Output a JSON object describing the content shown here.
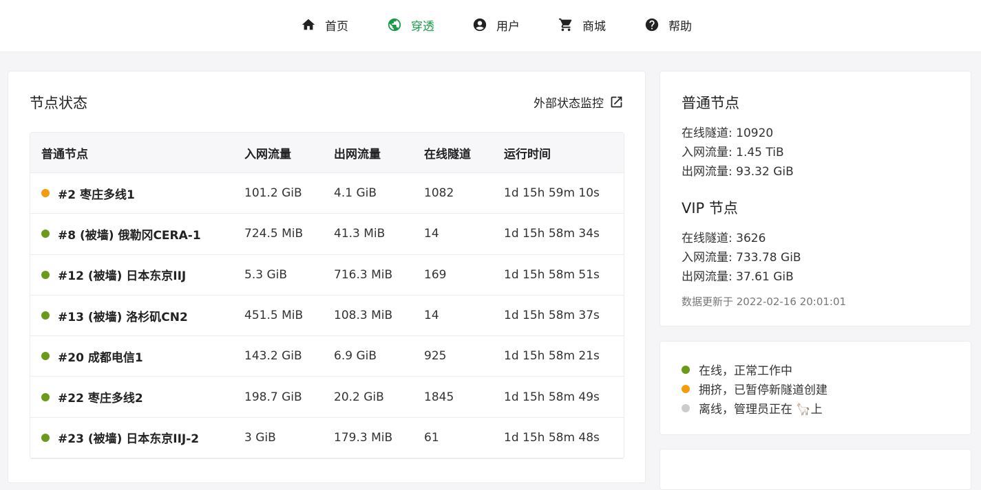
{
  "nav": {
    "items": [
      {
        "label": "首页",
        "icon": "home-icon"
      },
      {
        "label": "穿透",
        "icon": "globe-icon",
        "active": true
      },
      {
        "label": "用户",
        "icon": "account-circle-icon"
      },
      {
        "label": "商城",
        "icon": "shopping-cart-icon"
      },
      {
        "label": "帮助",
        "icon": "help-circle-icon"
      }
    ],
    "active_color": "#1a9a4a"
  },
  "node_status": {
    "title": "节点状态",
    "external_link": "外部状态监控",
    "columns": [
      "普通节点",
      "入网流量",
      "出网流量",
      "在线隧道",
      "运行时间"
    ],
    "rows": [
      {
        "status": "busy",
        "name": "#2 枣庄多线1",
        "in": "101.2 GiB",
        "out": "4.1 GiB",
        "tunnels": "1082",
        "uptime": "1d 15h 59m 10s"
      },
      {
        "status": "online",
        "name": "#8 (被墙) 俄勒冈CERA-1",
        "in": "724.5 MiB",
        "out": "41.3 MiB",
        "tunnels": "14",
        "uptime": "1d 15h 58m 34s"
      },
      {
        "status": "online",
        "name": "#12 (被墙) 日本东京IIJ",
        "in": "5.3 GiB",
        "out": "716.3 MiB",
        "tunnels": "169",
        "uptime": "1d 15h 58m 51s"
      },
      {
        "status": "online",
        "name": "#13 (被墙) 洛杉矶CN2",
        "in": "451.5 MiB",
        "out": "108.3 MiB",
        "tunnels": "14",
        "uptime": "1d 15h 58m 37s"
      },
      {
        "status": "online",
        "name": "#20 成都电信1",
        "in": "143.2 GiB",
        "out": "6.9 GiB",
        "tunnels": "925",
        "uptime": "1d 15h 58m 21s"
      },
      {
        "status": "online",
        "name": "#22 枣庄多线2",
        "in": "198.7 GiB",
        "out": "20.2 GiB",
        "tunnels": "1845",
        "uptime": "1d 15h 58m 49s"
      },
      {
        "status": "online",
        "name": "#23 (被墙) 日本东京IIJ-2",
        "in": "3 GiB",
        "out": "179.3 MiB",
        "tunnels": "61",
        "uptime": "1d 15h 58m 48s"
      }
    ]
  },
  "summary": {
    "normal": {
      "title": "普通节点",
      "tunnels": "在线隧道: 10920",
      "in": "入网流量: 1.45 TiB",
      "out": "出网流量: 93.32 GiB"
    },
    "vip": {
      "title": "VIP 节点",
      "tunnels": "在线隧道: 3626",
      "in": "入网流量: 733.78 GiB",
      "out": "出网流量: 37.61 GiB"
    },
    "updated": "数据更新于 2022-02-16 20:01:01"
  },
  "legend": [
    {
      "status": "online",
      "label": "在线，正常工作中"
    },
    {
      "status": "busy",
      "label": "拥挤，已暂停新隧道创建"
    },
    {
      "status": "offline",
      "label": "离线，管理员正在 🦙上"
    }
  ],
  "status_colors": {
    "online": "#6a9a1c",
    "busy": "#f39c12",
    "offline": "#cccccc"
  }
}
